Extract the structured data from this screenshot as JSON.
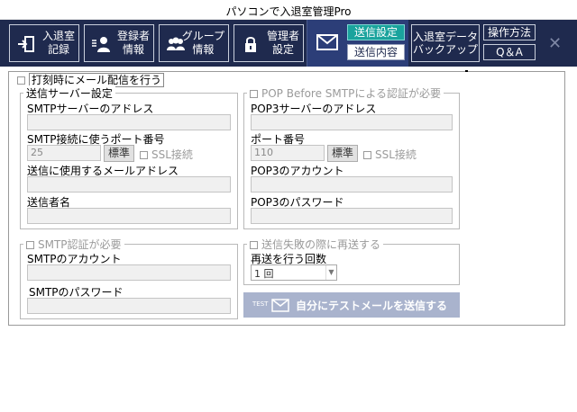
{
  "window": {
    "title": "パソコンで入退室管理Pro",
    "close_icon": "close-icon"
  },
  "toolbar": {
    "entry_record": "入退室\n記録",
    "registrant_info": "登録者\n情報",
    "group_info": "グループ\n情報",
    "admin_settings": "管理者\n設定",
    "send_settings": "送信設定",
    "send_content": "送信内容",
    "backup": "入退室データ\nバックアップ",
    "how_to": "操作方法",
    "qa": "Q＆A",
    "colors": {
      "bar": "#1f2a4e",
      "active_tab": "#1aa39d"
    }
  },
  "form": {
    "send_mail_on_stamp": "打刻時にメール配信を行う",
    "server_group": {
      "title": "送信サーバー設定",
      "smtp_address_label": "SMTPサーバーのアドレス",
      "smtp_address_value": "",
      "port_label": "SMTP接続に使うポート番号",
      "port_value": "25",
      "standard_btn": "標準",
      "ssl_label": "SSL接続",
      "from_address_label": "送信に使用するメールアドレス",
      "from_address_value": "",
      "sender_name_label": "送信者名",
      "sender_name_value": ""
    },
    "pop_group": {
      "title": "POP Before SMTPによる認証が必要",
      "pop3_address_label": "POP3サーバーのアドレス",
      "pop3_address_value": "",
      "port_label": "ポート番号",
      "port_value": "110",
      "standard_btn": "標準",
      "ssl_label": "SSL接続",
      "account_label": "POP3のアカウント",
      "account_value": "",
      "password_label": "POP3のパスワード",
      "password_value": ""
    },
    "smtp_auth_group": {
      "title": "SMTP認証が必要",
      "account_label": "SMTPのアカウント",
      "account_value": "",
      "password_label": "SMTPのパスワード",
      "password_value": ""
    },
    "retry_group": {
      "title": "送信失敗の際に再送する",
      "retry_count_label": "再送を行う回数",
      "retry_count_value": "1 回"
    },
    "test_send": {
      "badge": "TEST",
      "label": "自分にテストメールを送信する"
    }
  }
}
